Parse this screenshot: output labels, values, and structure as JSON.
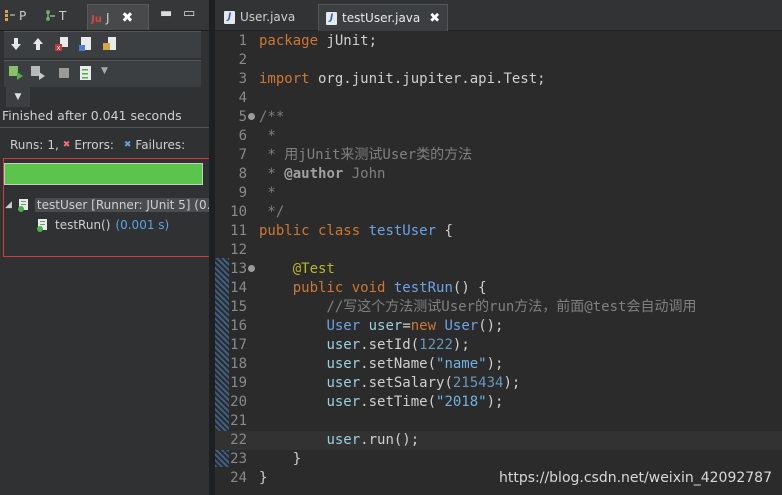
{
  "left_panel": {
    "tabs": [
      {
        "label": "P",
        "icon": "package-explorer-icon"
      },
      {
        "label": "T",
        "icon": "type-hierarchy-icon"
      },
      {
        "label": "J",
        "icon": "junit-icon"
      }
    ],
    "finished_text": "Finished after 0.041 seconds",
    "runs_label": "Runs:",
    "runs_value": "1,",
    "errors_label": "Errors:",
    "failures_label": "Failures:",
    "progress": 1.0,
    "progress_color": "#5bc44d",
    "tree": [
      {
        "label": "testUser [Runner: JUnit 5] (0.0",
        "icon": "test-suite-icon"
      },
      {
        "label": "testRun()",
        "duration": "(0.001 s)",
        "icon": "test-case-icon"
      }
    ]
  },
  "editor": {
    "tabs": [
      {
        "label": "User.java",
        "active": false
      },
      {
        "label": "testUser.java",
        "active": true
      }
    ],
    "watermark": "https://blog.csdn.net/weixin_42092787"
  }
}
